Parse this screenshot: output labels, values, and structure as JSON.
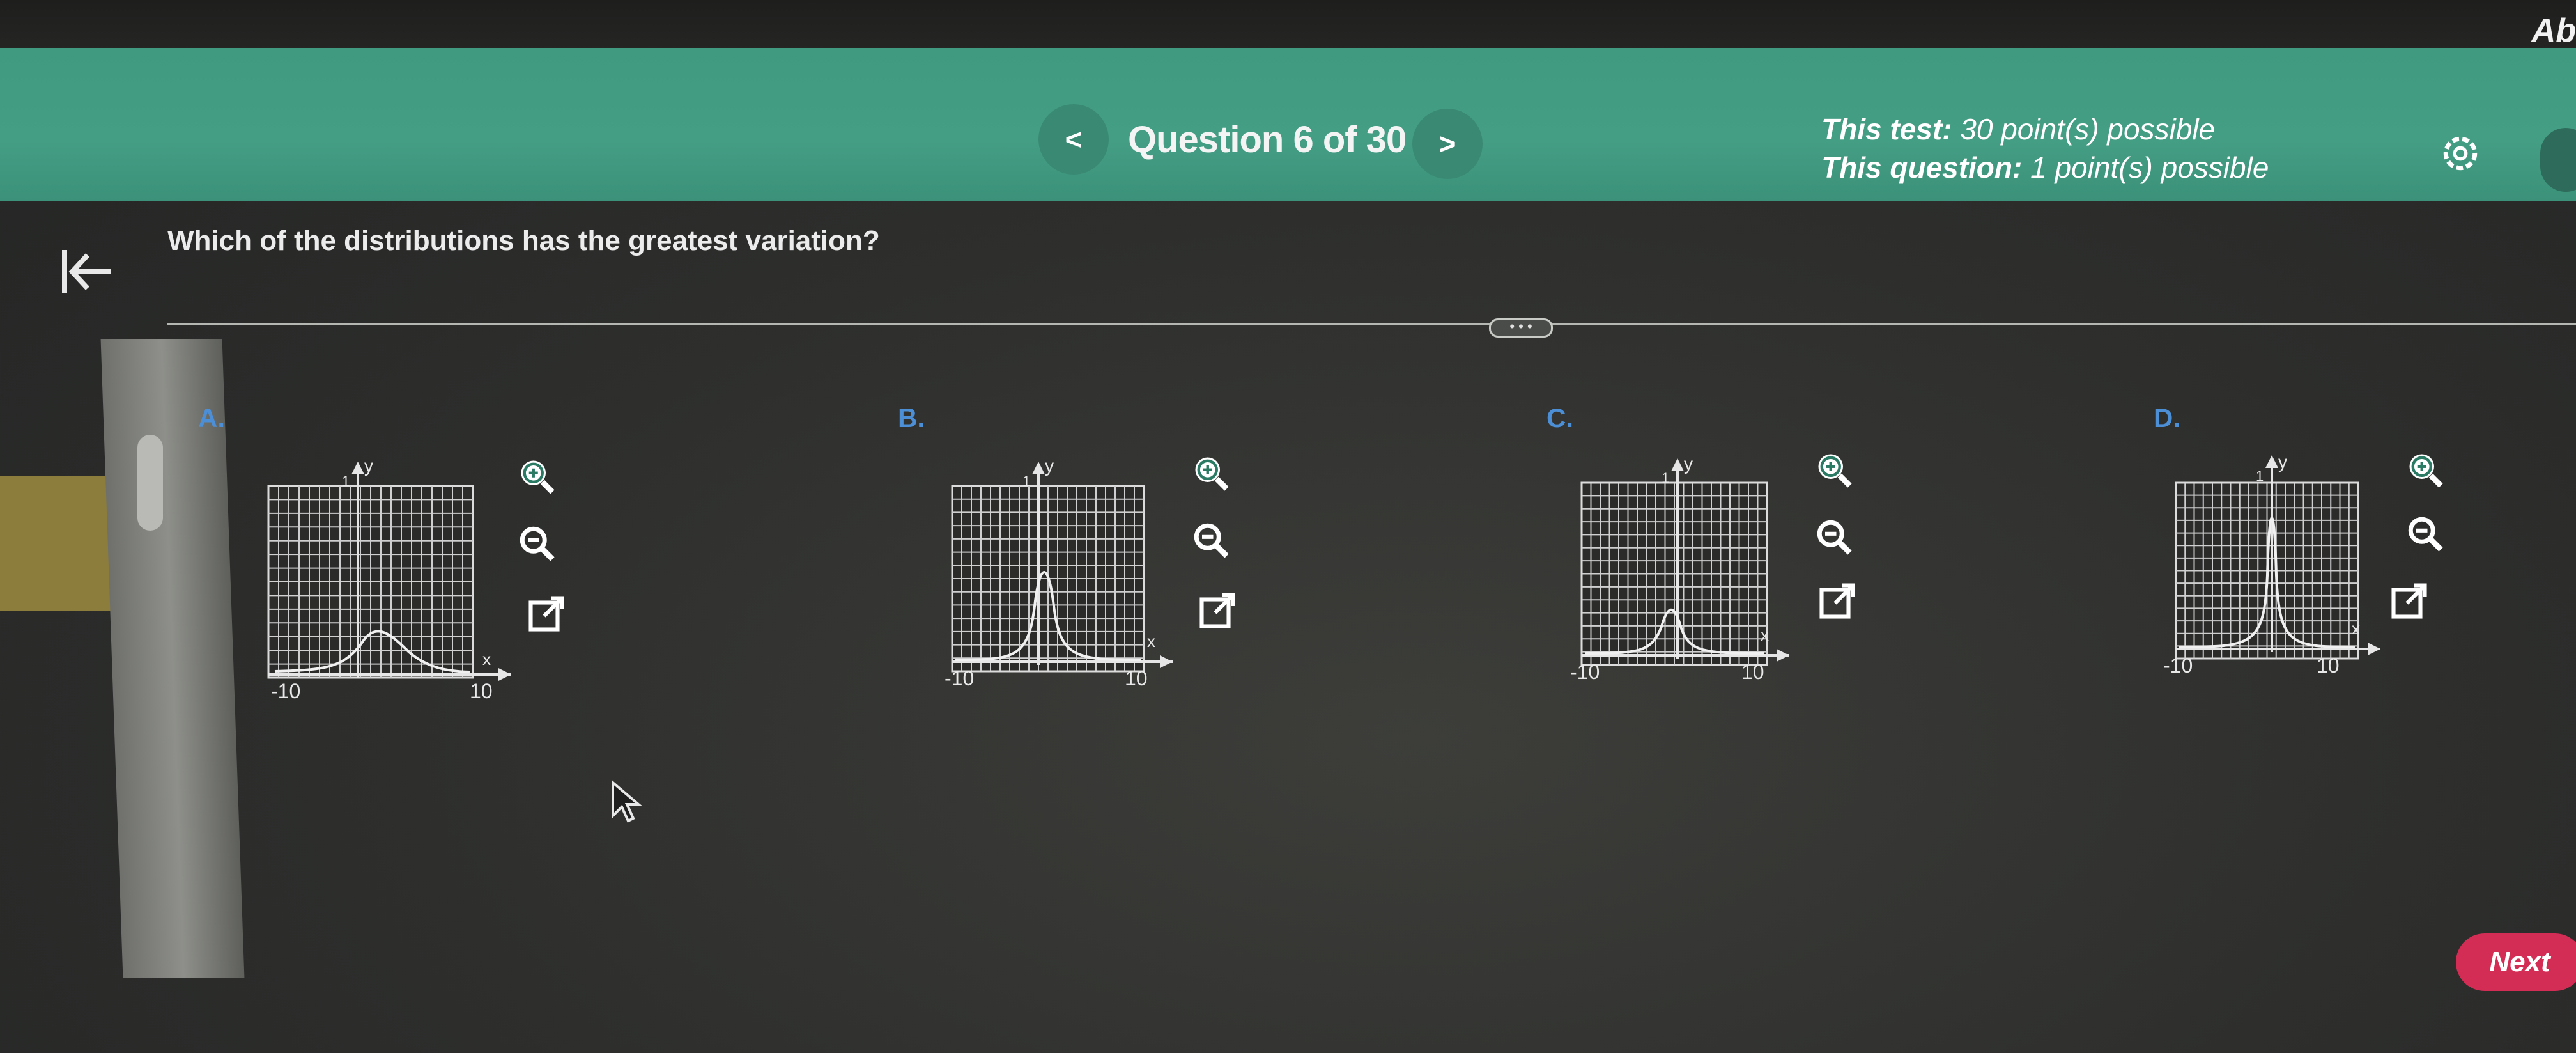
{
  "top_right_text": "Ab",
  "header": {
    "prev_label": "<",
    "title": "Question 6 of 30",
    "next_label": ">",
    "test_points_label": "This test:",
    "test_points_value": "30 point(s) possible",
    "question_points_label": "This question:",
    "question_points_value": "1 point(s) possible",
    "settings_icon": "gear-icon"
  },
  "question": {
    "text": "Which of the distributions has the greatest variation?"
  },
  "drag_handle": "• • •",
  "options": [
    {
      "label": "A.",
      "x_min": "-10",
      "x_max": "10",
      "x_axis": "x",
      "y_axis": "y",
      "y_tick": "1"
    },
    {
      "label": "B.",
      "x_min": "-10",
      "x_max": "10",
      "x_axis": "x",
      "y_axis": "y",
      "y_tick": "1"
    },
    {
      "label": "C.",
      "x_min": "-10",
      "x_max": "10",
      "x_axis": "x",
      "y_axis": "y",
      "y_tick": "1"
    },
    {
      "label": "D.",
      "x_min": "-10",
      "x_max": "10",
      "x_axis": "x",
      "y_axis": "y",
      "y_tick": "1"
    }
  ],
  "tools": {
    "zoom_in_icon": "zoom-in-icon",
    "zoom_out_icon": "zoom-out-icon",
    "popout_icon": "external-link-icon"
  },
  "footer": {
    "next_label": "Next"
  },
  "colors": {
    "header_green": "#449e84",
    "option_label_blue": "#4c8fd6",
    "next_button": "#d42d55"
  }
}
